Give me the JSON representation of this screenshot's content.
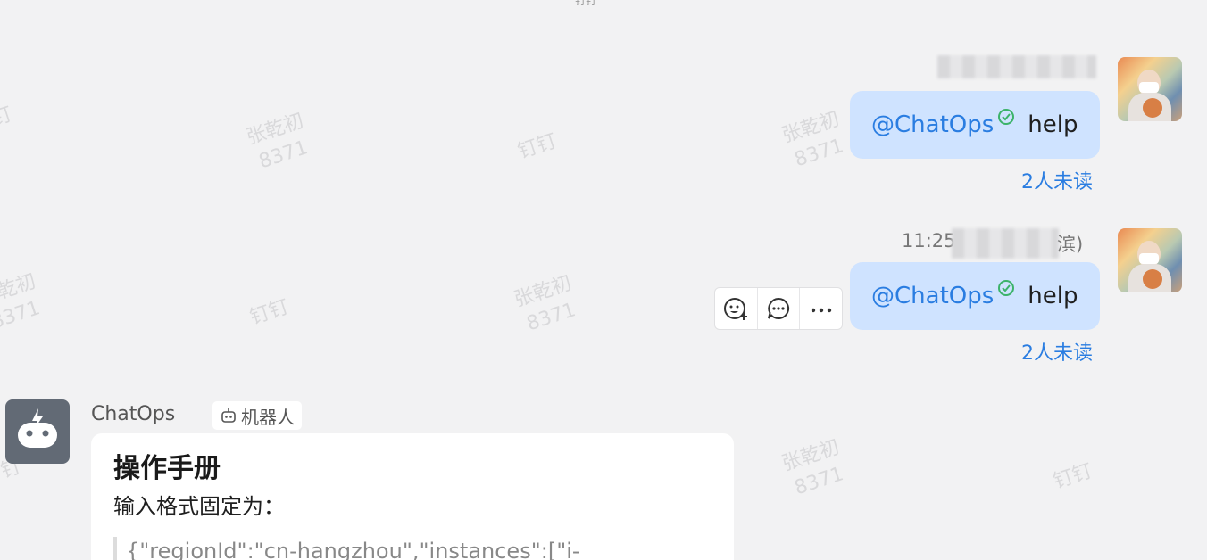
{
  "watermark": {
    "name": "张乾初",
    "id": "8371",
    "app": "钉钉"
  },
  "top_partial_text": "钉钉",
  "messages": [
    {
      "sender_name": "",
      "mention": "@ChatOps",
      "text": "help",
      "read_status": "2人未读"
    },
    {
      "timestamp": "11:25",
      "sender_suffix": "滨)",
      "mention": "@ChatOps",
      "text": "help",
      "read_status": "2人未读"
    }
  ],
  "toolbar": {
    "items": [
      {
        "icon": "add-reaction-icon"
      },
      {
        "icon": "reply-comment-icon"
      },
      {
        "icon": "more-icon"
      }
    ]
  },
  "bot": {
    "name": "ChatOps",
    "tag": "机器人",
    "card": {
      "title": "操作手册",
      "line": "输入格式固定为：",
      "quote": "{\"regionId\":\"cn-hangzhou\",\"instances\":[\"i-"
    }
  },
  "colors": {
    "background": "#f2f2f3",
    "bubble": "#cfe3ff",
    "accent": "#2a7de1",
    "check": "#3cb36a",
    "bot_avatar": "#626a75"
  }
}
